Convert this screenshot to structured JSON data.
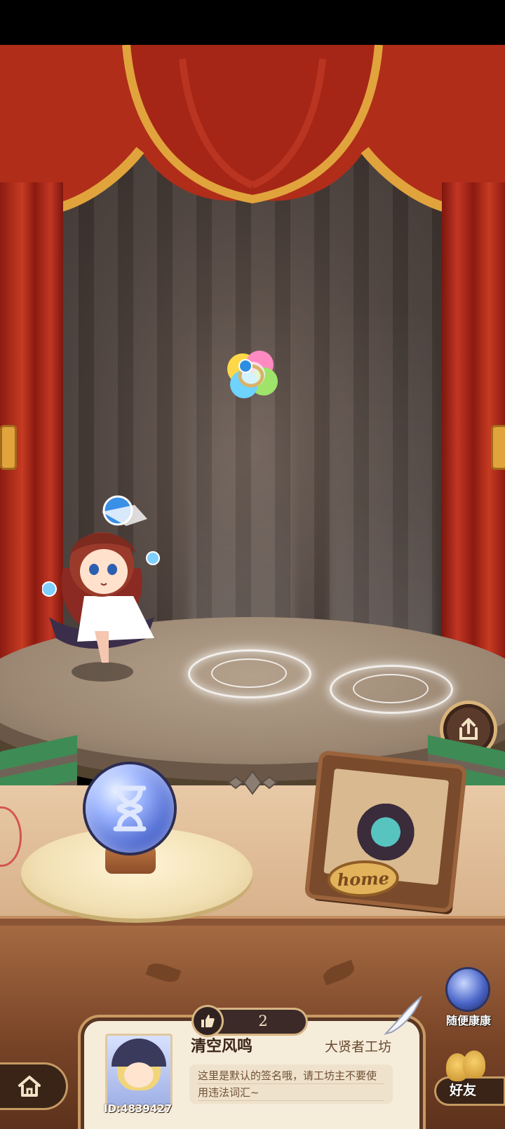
{
  "like_bar": {
    "count": "2"
  },
  "profile": {
    "player_name": "清空风鸣",
    "workshop_title": "大贤者工坊",
    "signature": "这里是默认的签名哦，请工坊主不要使用违法词汇~",
    "user_id": "ID:4839427"
  },
  "random_visit": {
    "label": "随便康康"
  },
  "friends": {
    "label": "好友"
  },
  "home_frame": {
    "plaque": "home"
  },
  "icons": {
    "hourglass": "hourglass-icon",
    "share": "share-icon",
    "house": "house-icon",
    "thumbs_up": "thumbs-up-icon"
  },
  "colors": {
    "curtain_red": "#c63b22",
    "gold_trim": "#e1a33c",
    "wood_dark": "#3a2418",
    "card_bg": "#f6ecda"
  }
}
